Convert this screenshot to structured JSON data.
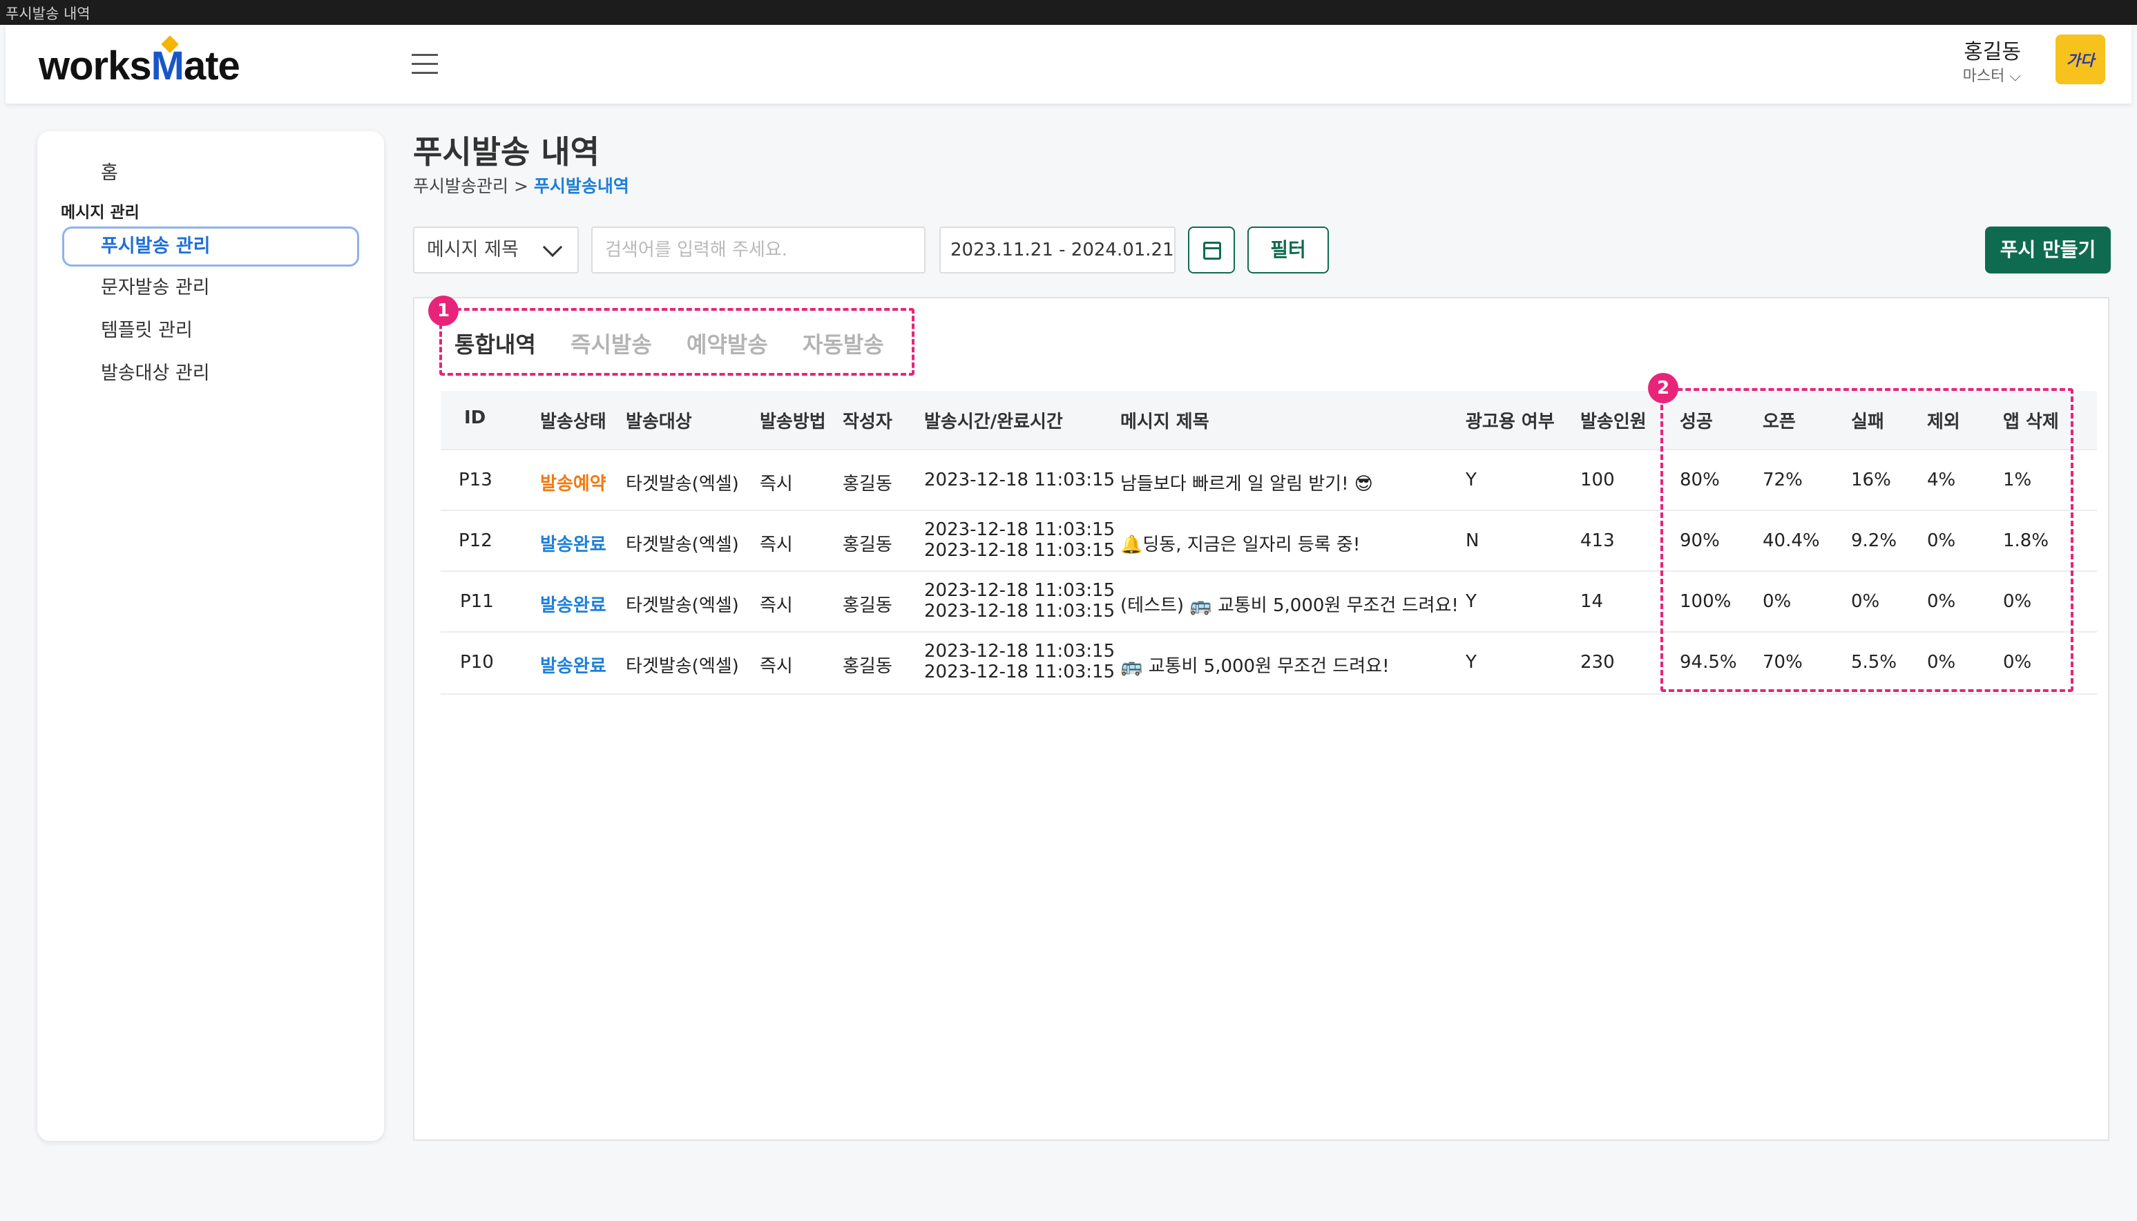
{
  "window_title": "푸시발송 내역",
  "header": {
    "logo_prefix": "works",
    "logo_m": "M",
    "logo_suffix": "ate",
    "user_name": "홍길동",
    "user_role": "마스터 ⌵",
    "avatar_text": "가다"
  },
  "sidebar": {
    "home": "홈",
    "section": "메시지 관리",
    "items": [
      {
        "label": "푸시발송 관리",
        "active": true
      },
      {
        "label": "문자발송 관리",
        "active": false
      },
      {
        "label": "템플릿 관리",
        "active": false
      },
      {
        "label": "발송대상 관리",
        "active": false
      }
    ]
  },
  "page": {
    "title": "푸시발송 내역",
    "breadcrumb_parent": "푸시발송관리 > ",
    "breadcrumb_current": "푸시발송내역"
  },
  "toolbar": {
    "select_value": "메시지 제목",
    "search_placeholder": "검색어를 입력해 주세요.",
    "date_range": "2023.11.21 - 2024.01.21",
    "filter_label": "필터",
    "create_label": "푸시 만들기"
  },
  "tabs": [
    "통합내역",
    "즉시발송",
    "예약발송",
    "자동발송"
  ],
  "markers": [
    "1",
    "2"
  ],
  "table": {
    "headers": [
      "ID",
      "발송상태",
      "발송대상",
      "발송방법",
      "작성자",
      "발송시간/완료시간",
      "메시지 제목",
      "광고용 여부",
      "발송인원",
      "성공",
      "오픈",
      "실패",
      "제외",
      "앱 삭제"
    ],
    "rows": [
      {
        "id": "P13",
        "status": "발송예약",
        "target": "타겟발송(엑셀)",
        "method": "즉시",
        "author": "홍길동",
        "time1": "2023-12-18 11:03:15",
        "time2": "",
        "title": "남들보다 빠르게 일 알림 받기! 😎",
        "ad": "Y",
        "count": "100",
        "success": "80%",
        "open": "72%",
        "fail": "16%",
        "excluded": "4%",
        "deleted": "1%"
      },
      {
        "id": "P12",
        "status": "발송완료",
        "target": "타겟발송(엑셀)",
        "method": "즉시",
        "author": "홍길동",
        "time1": "2023-12-18 11:03:15",
        "time2": "2023-12-18 11:03:15",
        "title": "🔔딩동, 지금은 일자리 등록 중!",
        "ad": "N",
        "count": "413",
        "success": "90%",
        "open": "40.4%",
        "fail": "9.2%",
        "excluded": "0%",
        "deleted": "1.8%"
      },
      {
        "id": "P11",
        "status": "발송완료",
        "target": "타겟발송(엑셀)",
        "method": "즉시",
        "author": "홍길동",
        "time1": "2023-12-18 11:03:15",
        "time2": "2023-12-18 11:03:15",
        "title": "(테스트) 🚌 교통비 5,000원 무조건 드려요!",
        "ad": "Y",
        "count": "14",
        "success": "100%",
        "open": "0%",
        "fail": "0%",
        "excluded": "0%",
        "deleted": "0%"
      },
      {
        "id": "P10",
        "status": "발송완료",
        "target": "타겟발송(엑셀)",
        "method": "즉시",
        "author": "홍길동",
        "time1": "2023-12-18 11:03:15",
        "time2": "2023-12-18 11:03:15",
        "title": "🚌 교통비 5,000원 무조건 드려요!",
        "ad": "Y",
        "count": "230",
        "success": "94.5%",
        "open": "70%",
        "fail": "5.5%",
        "excluded": "0%",
        "deleted": "0%"
      }
    ]
  },
  "colors": {
    "brand_green": "#0f6b4f",
    "link_blue": "#1e7fd9",
    "reserved_orange": "#f07a12",
    "annotation_pink": "#e8247a"
  }
}
